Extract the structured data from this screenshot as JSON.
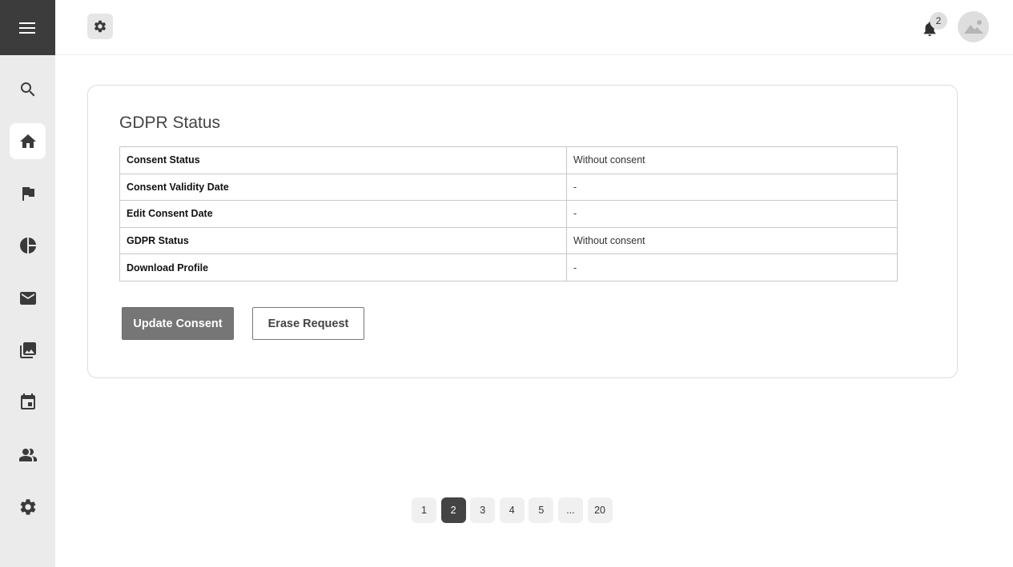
{
  "topbar": {
    "notification_count": "2"
  },
  "sidebar": {
    "items": [
      {
        "name": "search",
        "icon": "search-icon",
        "active": false
      },
      {
        "name": "home",
        "icon": "home-icon",
        "active": true
      },
      {
        "name": "flag",
        "icon": "flag-icon",
        "active": false
      },
      {
        "name": "analytics",
        "icon": "pie-chart-icon",
        "active": false
      },
      {
        "name": "mail",
        "icon": "mail-icon",
        "active": false
      },
      {
        "name": "gallery",
        "icon": "photo-library-icon",
        "active": false
      },
      {
        "name": "calendar",
        "icon": "calendar-icon",
        "active": false
      },
      {
        "name": "people",
        "icon": "people-icon",
        "active": false
      },
      {
        "name": "settings",
        "icon": "gear-icon",
        "active": false
      }
    ]
  },
  "card": {
    "title": "GDPR Status",
    "rows": [
      {
        "label": "Consent Status",
        "value": "Without consent"
      },
      {
        "label": "Consent Validity Date",
        "value": "-"
      },
      {
        "label": "Edit Consent Date",
        "value": "-"
      },
      {
        "label": "GDPR Status",
        "value": "Without consent"
      },
      {
        "label": "Download Profile",
        "value": "-"
      }
    ],
    "update_button": "Update Consent",
    "erase_button": "Erase Request"
  },
  "pagination": {
    "pages": [
      "1",
      "2",
      "3",
      "4",
      "5",
      "...",
      "20"
    ],
    "current": "2"
  },
  "colors": {
    "sidebar_bg": "#ebebeb",
    "menu_bg": "#3c3c3c",
    "primary_button": "#767676",
    "active_page": "#444444"
  }
}
